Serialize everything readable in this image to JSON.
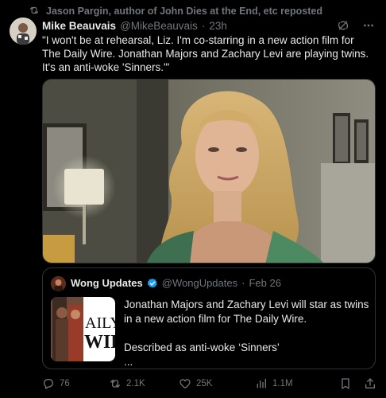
{
  "repost": {
    "text": "Jason Pargin, author of John Dies at the End, etc reposted",
    "icon": "repost-icon"
  },
  "tweet": {
    "author_name": "Mike Beauvais",
    "handle": "@MikeBeauvais",
    "separator": "·",
    "time": "23h",
    "text": "\"I won't be at rehearsal, Liz. I'm co-starring in a new action film for The Daily Wire. Jonathan Majors and Zachary Levi are playing twins. It's an anti-woke 'Sinners.'\"",
    "icons": [
      "grok-icon",
      "more-icon"
    ]
  },
  "quote": {
    "author_name": "Wong Updates",
    "handle": "@WongUpdates",
    "separator": "·",
    "date": "Feb 26",
    "thumbnail_text": [
      "AILY",
      "WIR"
    ],
    "paragraph1": "Jonathan Majors and Zachary Levi will star as twins in a new action film for The Daily Wire.",
    "paragraph2": "Described as anti-woke ‘Sinners’",
    "ellipsis": "..."
  },
  "actions": {
    "replies": "76",
    "reposts": "2.1K",
    "likes": "25K",
    "views": "1.1M"
  },
  "colors": {
    "background": "#000000",
    "text": "#e7e9ea",
    "secondary": "#71767b",
    "border": "#2f3336",
    "verified": "#1d9bf0"
  }
}
